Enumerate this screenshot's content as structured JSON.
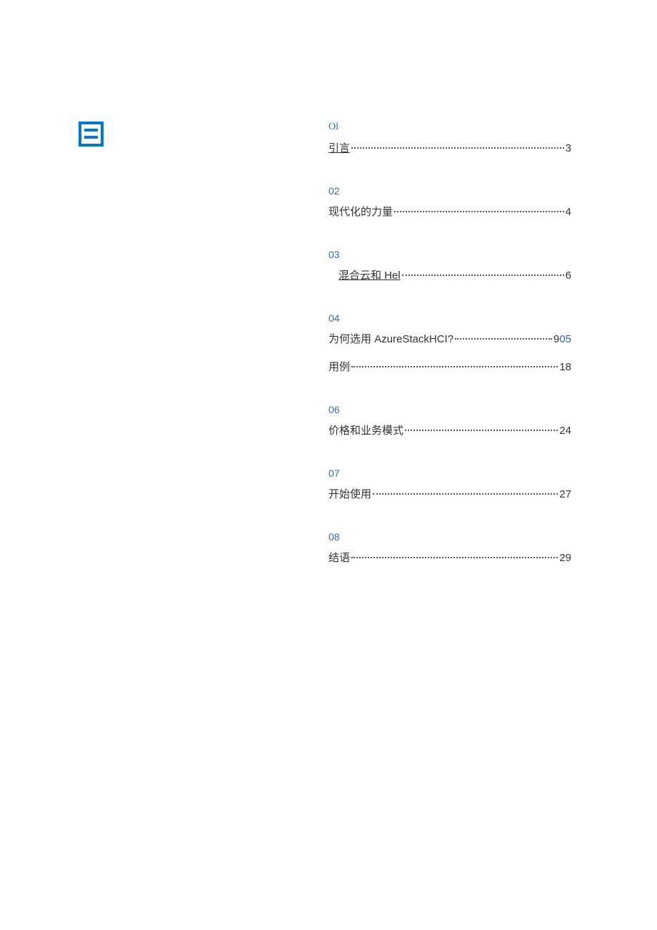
{
  "toc": {
    "sections": [
      {
        "num": "Ol",
        "serif": true,
        "entries": [
          {
            "title": "引言",
            "page": "3",
            "underline": true
          }
        ]
      },
      {
        "num": "02",
        "entries": [
          {
            "title": "现代化的力量",
            "page": "4"
          }
        ]
      },
      {
        "num": "03",
        "entries": [
          {
            "title": "混合云和 Hel",
            "page": "6",
            "underline": true,
            "indent": true
          }
        ]
      },
      {
        "num": "04",
        "entries": [
          {
            "title": "为何选用 AzureStackHCI?",
            "page": "9",
            "page_suffix": "05"
          },
          {
            "title": "用例",
            "page": "18"
          }
        ]
      },
      {
        "num": "06",
        "entries": [
          {
            "title": "价格和业务模式",
            "page": "24"
          }
        ]
      },
      {
        "num": "07",
        "entries": [
          {
            "title": "开始使用",
            "page": "27"
          }
        ]
      },
      {
        "num": "08",
        "entries": [
          {
            "title": "结语",
            "page": "29"
          }
        ]
      }
    ]
  }
}
